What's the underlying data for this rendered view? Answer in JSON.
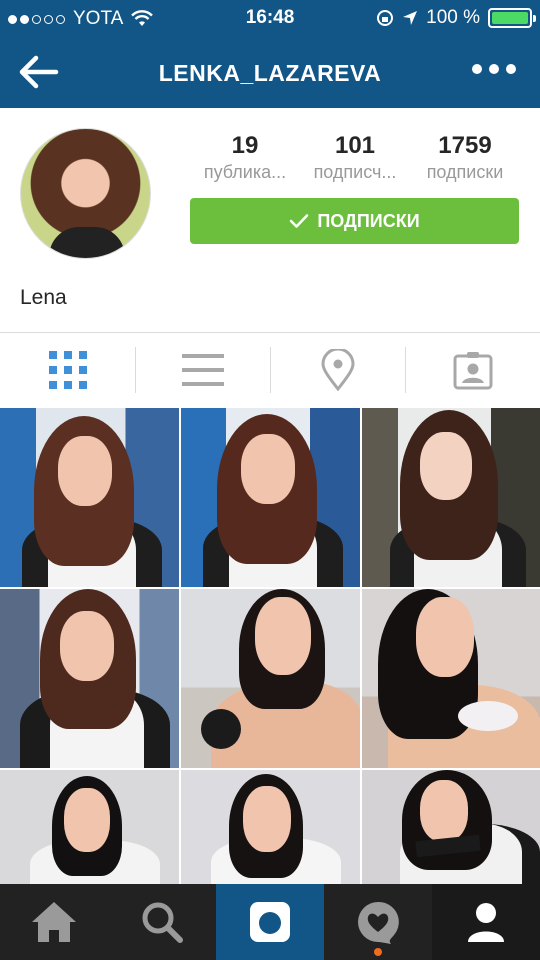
{
  "status_bar": {
    "carrier": "YOTA",
    "time": "16:48",
    "battery_percent": "100 %",
    "battery_color": "#4cd964"
  },
  "header": {
    "title": "LENKA_LAZAREVA",
    "back_icon": "back-arrow-icon",
    "more_icon": "more-dots-icon",
    "background": "#125688"
  },
  "profile": {
    "name": "Lena",
    "stats": [
      {
        "value": "19",
        "label": "публика..."
      },
      {
        "value": "101",
        "label": "подписч..."
      },
      {
        "value": "1759",
        "label": "подписки"
      }
    ],
    "follow_button": {
      "label": "ПОДПИСКИ",
      "icon": "check-icon",
      "color": "#6bbf3c"
    }
  },
  "tabs": [
    {
      "name": "grid-view",
      "icon": "grid-icon",
      "active": true
    },
    {
      "name": "list-view",
      "icon": "list-icon",
      "active": false
    },
    {
      "name": "map-view",
      "icon": "location-pin-icon",
      "active": false
    },
    {
      "name": "tagged-view",
      "icon": "tagged-person-icon",
      "active": false
    }
  ],
  "bottom_nav": [
    {
      "name": "home",
      "icon": "home-icon"
    },
    {
      "name": "explore",
      "icon": "search-icon"
    },
    {
      "name": "camera",
      "icon": "camera-icon",
      "active": true
    },
    {
      "name": "activity",
      "icon": "heart-bubble-icon",
      "notification": true
    },
    {
      "name": "profile",
      "icon": "profile-icon",
      "selected": true
    }
  ]
}
